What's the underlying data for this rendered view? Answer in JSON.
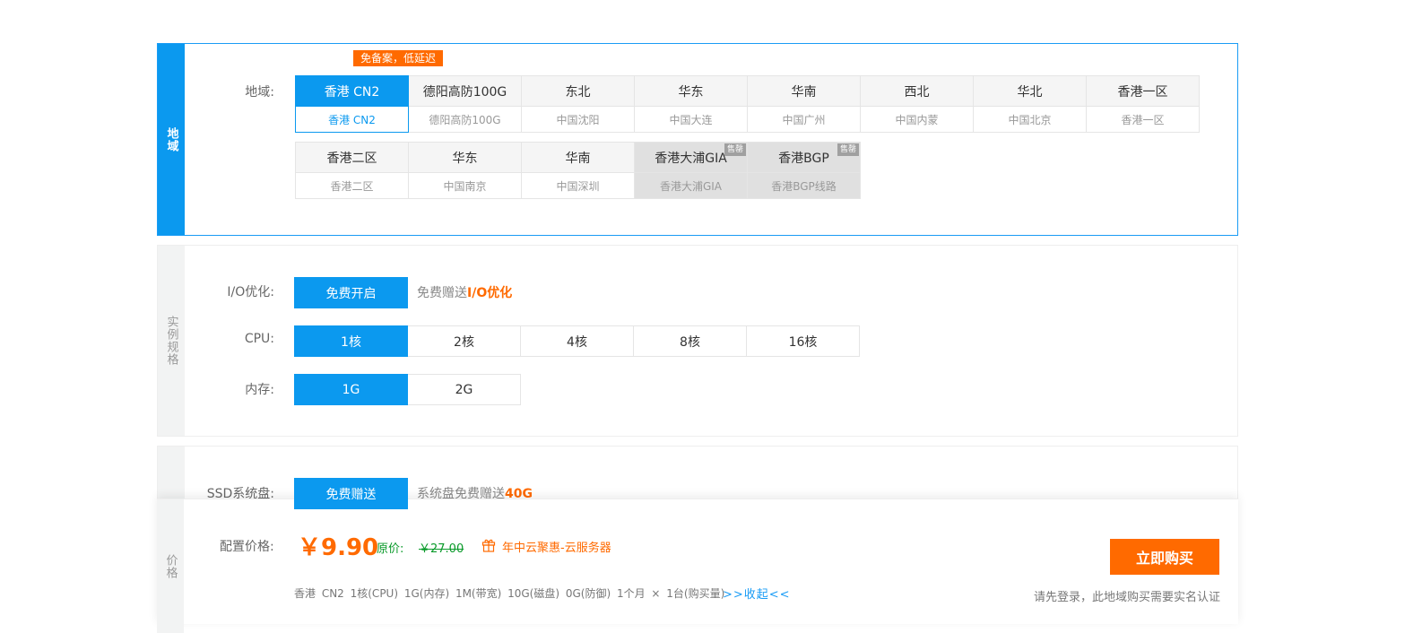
{
  "region": {
    "side_label": "地域",
    "label": "地域:",
    "promo_tag": "免备案，低延迟",
    "row1": [
      {
        "name": "香港 CN2",
        "sub": "香港 CN2",
        "state": "active"
      },
      {
        "name": "德阳高防100G",
        "sub": "德阳高防100G",
        "state": "normal"
      },
      {
        "name": "东北",
        "sub": "中国沈阳",
        "state": "normal"
      },
      {
        "name": "华东",
        "sub": "中国大连",
        "state": "normal"
      },
      {
        "name": "华南",
        "sub": "中国广州",
        "state": "normal"
      },
      {
        "name": "西北",
        "sub": "中国内蒙",
        "state": "normal"
      },
      {
        "name": "华北",
        "sub": "中国北京",
        "state": "normal"
      },
      {
        "name": "香港一区",
        "sub": "香港一区",
        "state": "normal"
      }
    ],
    "row2": [
      {
        "name": "香港二区",
        "sub": "香港二区",
        "state": "normal"
      },
      {
        "name": "华东",
        "sub": "中国南京",
        "state": "normal"
      },
      {
        "name": "华南",
        "sub": "中国深圳",
        "state": "normal"
      },
      {
        "name": "香港大浦GIA",
        "sub": "香港大浦GIA",
        "state": "disabled",
        "badge": "售罄"
      },
      {
        "name": "香港BGP",
        "sub": "香港BGP线路",
        "state": "disabled",
        "badge": "售罄"
      }
    ]
  },
  "spec": {
    "side_label": "实例规格",
    "io_label": "I/O优化:",
    "io_button": "免费开启",
    "io_note_prefix": "免费赠送",
    "io_note_highlight": "I/O优化",
    "cpu_label": "CPU:",
    "cpu_options": [
      {
        "label": "1核",
        "active": true
      },
      {
        "label": "2核",
        "active": false
      },
      {
        "label": "4核",
        "active": false
      },
      {
        "label": "8核",
        "active": false
      },
      {
        "label": "16核",
        "active": false
      }
    ],
    "mem_label": "内存:",
    "mem_options": [
      {
        "label": "1G",
        "active": true
      },
      {
        "label": "2G",
        "active": false
      }
    ]
  },
  "disk": {
    "label": "SSD系统盘:",
    "button": "免费赠送",
    "note_prefix": "系统盘免费赠送",
    "note_highlight": "40G"
  },
  "price": {
    "side_label": "价格",
    "label": "配置价格:",
    "main": "￥9.90",
    "orig_label": "原价:",
    "orig_price": "￥27.00",
    "promo": "年中云聚惠-云服务器",
    "summary": "香港 CN2  1核(CPU)  1G(内存)  1M(带宽)  10G(磁盘)  0G(防御)  1个月 × 1台(购买量)",
    "collapse": ">>收起<<",
    "buy_button": "立即购买",
    "login_note": "请先登录，此地域购买需要实名认证"
  }
}
